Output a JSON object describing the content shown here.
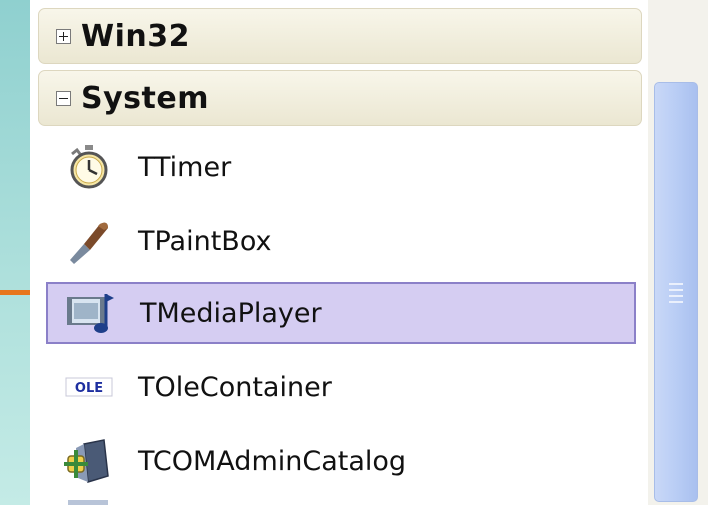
{
  "palette": {
    "categories": [
      {
        "label": "Win32",
        "expanded": false,
        "expander": "plus"
      },
      {
        "label": "System",
        "expanded": true,
        "expander": "minus"
      }
    ],
    "items": [
      {
        "label": "TTimer",
        "icon": "stopwatch-icon",
        "selected": false
      },
      {
        "label": "TPaintBox",
        "icon": "paintbrush-icon",
        "selected": false
      },
      {
        "label": "TMediaPlayer",
        "icon": "media-player-icon",
        "selected": true
      },
      {
        "label": "TOleContainer",
        "icon": "ole-icon",
        "selected": false
      },
      {
        "label": "TCOMAdminCatalog",
        "icon": "com-admin-icon",
        "selected": false
      }
    ],
    "ole_icon_text": "OLE"
  },
  "colors": {
    "selection_fill": "#d5cdf2",
    "selection_border": "#8b80c8",
    "pointer_arrow": "#e8761c",
    "background": "#8fd0cf"
  }
}
